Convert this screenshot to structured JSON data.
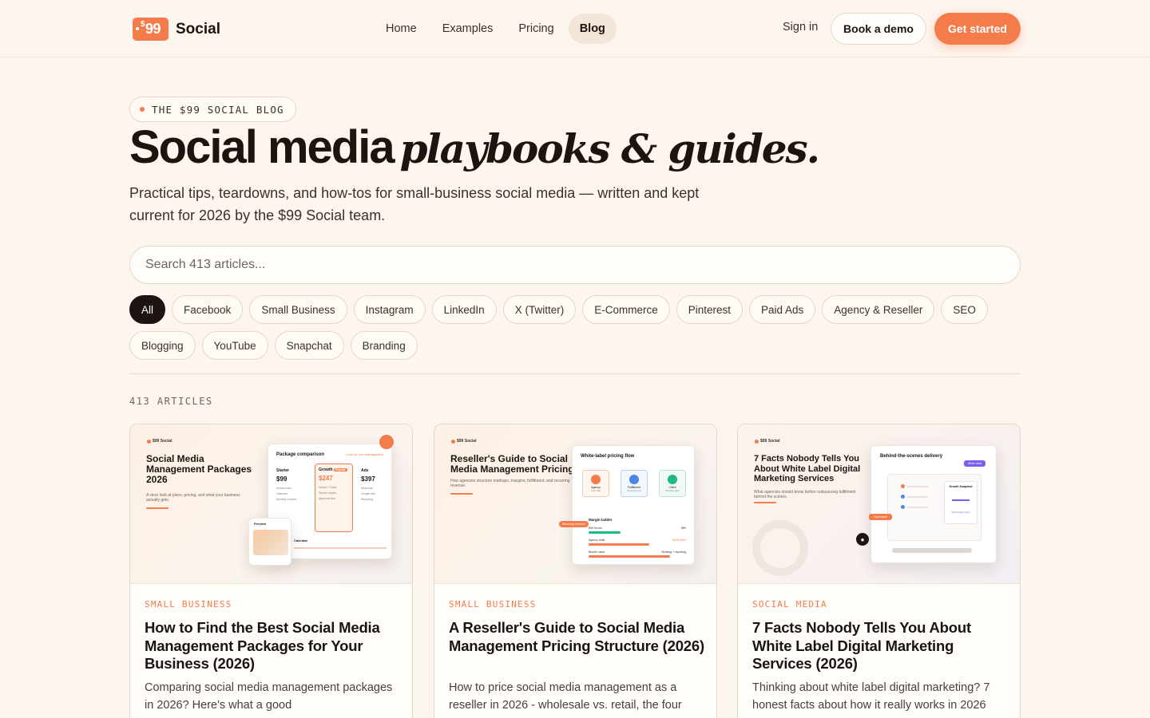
{
  "brand": {
    "badge": "99",
    "badge_symbol": "$",
    "name": "Social"
  },
  "nav": {
    "links": [
      {
        "label": "Home"
      },
      {
        "label": "Examples"
      },
      {
        "label": "Pricing"
      },
      {
        "label": "Blog",
        "active": true
      }
    ],
    "signin": "Sign in",
    "demo": "Book a demo",
    "start": "Get started"
  },
  "hero": {
    "eyebrow": "THE $99 SOCIAL BLOG",
    "title_bold": "Social media",
    "title_italic": "playbooks & guides.",
    "subtitle": "Practical tips, teardowns, and how-tos for small-business social media — written and kept current for 2026 by the $99 Social team."
  },
  "search": {
    "placeholder": "Search 413 articles..."
  },
  "categories": [
    "All",
    "Facebook",
    "Small Business",
    "Instagram",
    "LinkedIn",
    "X (Twitter)",
    "E-Commerce",
    "Pinterest",
    "Paid Ads",
    "Agency & Reseller",
    "SEO",
    "Blogging",
    "YouTube",
    "Snapchat",
    "Branding"
  ],
  "active_category": "All",
  "article_count": "413 ARTICLES",
  "colors": {
    "accent": "#f47b4a",
    "background": "#fdf6ee",
    "ink": "#1c1410"
  },
  "cards": [
    {
      "tag": "SMALL BUSINESS",
      "title": "How to Find the Best Social Media Management Packages for Your Business (2026)",
      "desc": "Comparing social media management packages in 2026? Here's what a good",
      "thumb": {
        "brand": "$99 Social",
        "title": "Social Media Management Packages 2026",
        "desc": "A clear look at plans, pricing, and what your business actually gets.",
        "panel_title": "Package comparison",
        "panel_note": "Look for real management",
        "tiers": [
          {
            "name": "Starter",
            "price": "$99",
            "items": [
              "Social posts",
              "Calendar",
              "Monthly content"
            ]
          },
          {
            "name": "Growth",
            "price": "$247",
            "badge": "Popular",
            "items": [
              "Social + Posts",
              "Stories replies",
              "Approval flow"
            ]
          },
          {
            "name": "Ads",
            "price": "$397",
            "items": [
              "Meta Ads",
              "Google Ads",
              "Reporting"
            ]
          }
        ],
        "preview": "Preview",
        "calendar": "Calendar"
      }
    },
    {
      "tag": "SMALL BUSINESS",
      "title": "A Reseller's Guide to Social Media Management Pricing Structure (2026)",
      "desc": "How to price social media management as a reseller in 2026 - wholesale vs. retail, the four",
      "thumb": {
        "brand": "$99 Social",
        "title": "Reseller's Guide to Social Media Management Pricing",
        "desc": "How agencies structure markups, margins, fulfillment, and recurring revenue.",
        "panel_title": "White-label pricing flow",
        "nodes": [
          {
            "name": "Agency",
            "sub": "Your offer"
          },
          {
            "name": "Fulfillment",
            "sub": "Done-for-you"
          },
          {
            "name": "Client",
            "sub": "Monthly plan"
          }
        ],
        "ladder_title": "Margin ladder",
        "ladder_tag": "Recurring revenue",
        "rows": [
          {
            "label": "$99 Social",
            "value": "$99"
          },
          {
            "label": "Agency retail",
            "value": "$249-$499"
          },
          {
            "label": "Bundle value",
            "value": "Strategy + reporting"
          }
        ]
      }
    },
    {
      "tag": "SOCIAL MEDIA",
      "title": "7 Facts Nobody Tells You About White Label Digital Marketing Services (2026)",
      "desc": "Thinking about white label digital marketing? 7 honest facts about how it really works in 2026",
      "thumb": {
        "brand": "$99 Social",
        "title": "7 Facts Nobody Tells You About White Label Digital Marketing Services",
        "desc": "What agencies should know before outsourcing fulfillment behind the scenes.",
        "panel_title": "Behind-the-scenes delivery",
        "badge": "White label",
        "snapshot": "Growth Snapshot",
        "snapshot_note": "Client-ready report",
        "flow_tag": "Your brand"
      }
    }
  ]
}
